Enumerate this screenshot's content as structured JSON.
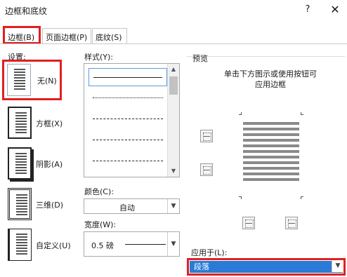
{
  "window": {
    "title": "边框和底纹",
    "help_label": "?",
    "close_label": "✕"
  },
  "tabs": [
    {
      "label": "边框(B)",
      "active": true
    },
    {
      "label": "页面边框(P)",
      "active": false
    },
    {
      "label": "底纹(S)",
      "active": false
    }
  ],
  "settings": {
    "label": "设置:",
    "options": [
      {
        "label": "无(N)",
        "selected": true
      },
      {
        "label": "方框(X)",
        "selected": false
      },
      {
        "label": "阴影(A)",
        "selected": false
      },
      {
        "label": "三维(D)",
        "selected": false
      },
      {
        "label": "自定义(U)",
        "selected": false
      }
    ]
  },
  "style": {
    "label": "样式(Y):",
    "options": [
      "solid",
      "dotted",
      "dashed",
      "dash-large",
      "dash-dot"
    ],
    "selected": "solid"
  },
  "color": {
    "label": "颜色(C):",
    "value": "自动"
  },
  "width": {
    "label": "宽度(W):",
    "value": "0.5 磅"
  },
  "preview": {
    "label": "预览",
    "note_line1": "单击下方图示或使用按钮可",
    "note_line2": "应用边框"
  },
  "apply_to": {
    "label": "应用于(L):",
    "value": "段落"
  },
  "colors": {
    "highlight": "#e02020",
    "selection": "#2a7bd6"
  }
}
